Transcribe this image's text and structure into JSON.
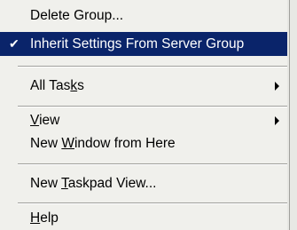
{
  "menu": {
    "items": [
      {
        "label": "Delete Group...",
        "pre": "Delete Group...",
        "ul": "",
        "post": "",
        "checked": false,
        "submenu": false,
        "highlighted": false
      },
      {
        "label": "Inherit Settings From Server Group",
        "pre": "Inherit Settings From Server Group",
        "ul": "",
        "post": "",
        "checked": true,
        "submenu": false,
        "highlighted": true
      },
      {
        "label": "All Tasks",
        "pre": "All Tas",
        "ul": "k",
        "post": "s",
        "checked": false,
        "submenu": true,
        "highlighted": false
      },
      {
        "label": "View",
        "pre": "",
        "ul": "V",
        "post": "iew",
        "checked": false,
        "submenu": true,
        "highlighted": false
      },
      {
        "label": "New Window from Here",
        "pre": "New ",
        "ul": "W",
        "post": "indow from Here",
        "checked": false,
        "submenu": false,
        "highlighted": false
      },
      {
        "label": "New Taskpad View...",
        "pre": "New ",
        "ul": "T",
        "post": "askpad View...",
        "checked": false,
        "submenu": false,
        "highlighted": false
      },
      {
        "label": "Help",
        "pre": "",
        "ul": "H",
        "post": "elp",
        "checked": false,
        "submenu": false,
        "highlighted": false
      }
    ],
    "check_mark": "✔"
  },
  "colors": {
    "menu_bg": "#f0f0ec",
    "highlight_bg": "#0a246a",
    "highlight_text": "#ffffff",
    "separator": "#a0a09c"
  },
  "icons": {
    "check": "check-icon",
    "submenu": "submenu-arrow-icon"
  }
}
